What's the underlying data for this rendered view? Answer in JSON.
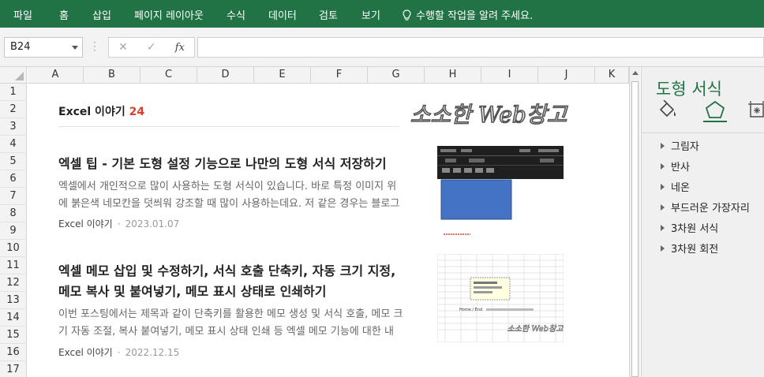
{
  "ribbon": {
    "tabs": [
      "파일",
      "홈",
      "삽입",
      "페이지 레이아웃",
      "수식",
      "데이터",
      "검토",
      "보기"
    ],
    "tell_me": "수행할 작업을 알려 주세요."
  },
  "formula_bar": {
    "name_box": "B24",
    "cancel_icon": "✕",
    "enter_icon": "✓",
    "fx_label": "fx",
    "formula": ""
  },
  "grid": {
    "columns": [
      "A",
      "B",
      "C",
      "D",
      "E",
      "F",
      "G",
      "H",
      "I",
      "J",
      "K"
    ],
    "rows": [
      "1",
      "2",
      "3",
      "4",
      "5",
      "6",
      "7",
      "8",
      "9",
      "10",
      "11",
      "12",
      "13",
      "14",
      "15",
      "16",
      "17"
    ]
  },
  "blog": {
    "section_title": "Excel 이야기",
    "section_number": "24",
    "logo_text": "소소한 Web창고",
    "posts": [
      {
        "title": "엑셀 팁 - 기본 도형 설정 기능으로 나만의 도형 서식 저장하기",
        "desc": "엑셀에서 개인적으로 많이 사용하는 도형 서식이 있습니다. 바로 특정 이미지 위에 붉은색 네모칸을 덧씌워 강조할 때 많이 사용하는데요. 저 같은 경우는 블로그 포...",
        "category": "Excel 이야기",
        "date": "2023.01.07"
      },
      {
        "title": "엑셀 메모 삽입 및 수정하기, 서식 호출 단축키, 자동 크기 지정, 메모 복사 및 붙여넣기, 메모 표시 상태로 인쇄하기",
        "desc": "이번 포스팅에서는 제목과 같이 단축키를 활용한 메모 생성 및 서식 호출, 메모 크기 자동 조절, 복사 붙여넣기, 메모 표시 상태 인쇄 등 엑셀 메모 기능에 대한 내용...",
        "category": "Excel 이야기",
        "date": "2022.12.15"
      }
    ],
    "thumb2_label": "Home / End",
    "thumb2_logo": "소소한 Web창고"
  },
  "format_pane": {
    "title": "도형 서식",
    "icons": [
      "fill-bucket-icon",
      "pentagon-icon",
      "size-properties-icon"
    ],
    "items": [
      "그림자",
      "반사",
      "네온",
      "부드러운 가장자리",
      "3차원 서식",
      "3차원 회전"
    ]
  },
  "colors": {
    "ribbon": "#217346",
    "accent_red": "#e03e2d",
    "shape_fill": "#4472c4"
  }
}
